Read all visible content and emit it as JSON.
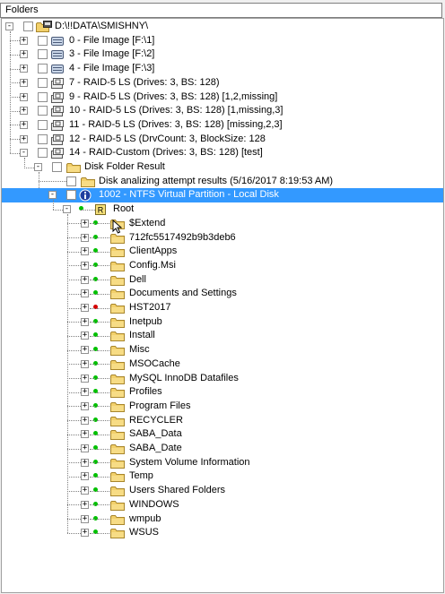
{
  "header": {
    "title": "Folders"
  },
  "tree": {
    "root": {
      "label": "D:\\!!DATA\\SMISHNY\\"
    },
    "items": [
      {
        "label": "0 - File Image [F:\\1]",
        "icon": "disk-image-icon"
      },
      {
        "label": "3 - File Image [F:\\2]",
        "icon": "disk-image-icon"
      },
      {
        "label": "4 - File Image [F:\\3]",
        "icon": "disk-image-icon"
      },
      {
        "label": "7 - RAID-5 LS (Drives: 3, BS: 128)",
        "icon": "raid-icon"
      },
      {
        "label": "9 - RAID-5 LS (Drives: 3, BS: 128) [1,2,missing]",
        "icon": "raid-icon"
      },
      {
        "label": "10 - RAID-5 LS (Drives: 3, BS: 128) [1,missing,3]",
        "icon": "raid-icon"
      },
      {
        "label": "11 - RAID-5 LS (Drives: 3, BS: 128) [missing,2,3]",
        "icon": "raid-icon"
      },
      {
        "label": "12 - RAID-5 LS (DrvCount: 3, BlockSize: 128",
        "icon": "raid-icon"
      },
      {
        "label": "14 - RAID-Custom (Drives: 3, BS: 128) [test]",
        "icon": "raid-icon"
      }
    ],
    "disk_folder": {
      "label": "Disk Folder Result"
    },
    "attempt": {
      "label": "Disk analizing attempt results (5/16/2017 8:19:53 AM)"
    },
    "partition": {
      "label": "1002 - NTFS Virtual Partition - Local Disk",
      "selected": true
    },
    "root_folder": {
      "label": "Root",
      "badge": "R"
    },
    "folders": [
      {
        "label": "$Extend",
        "status": "green",
        "cursor": true
      },
      {
        "label": "712fc5517492b9b3deb6",
        "status": "green"
      },
      {
        "label": "ClientApps",
        "status": "green"
      },
      {
        "label": "Config.Msi",
        "status": "green"
      },
      {
        "label": "Dell",
        "status": "green"
      },
      {
        "label": "Documents and Settings",
        "status": "green"
      },
      {
        "label": "HST2017",
        "status": "red"
      },
      {
        "label": "Inetpub",
        "status": "green"
      },
      {
        "label": "Install",
        "status": "green"
      },
      {
        "label": "Misc",
        "status": "green"
      },
      {
        "label": "MSOCache",
        "status": "green"
      },
      {
        "label": "MySQL InnoDB Datafiles",
        "status": "green"
      },
      {
        "label": "Profiles",
        "status": "green"
      },
      {
        "label": "Program Files",
        "status": "green"
      },
      {
        "label": "RECYCLER",
        "status": "green"
      },
      {
        "label": "SABA_Data",
        "status": "green"
      },
      {
        "label": "SABA_Date",
        "status": "green"
      },
      {
        "label": "System Volume Information",
        "status": "green"
      },
      {
        "label": "Temp",
        "status": "green"
      },
      {
        "label": "Users Shared Folders",
        "status": "green"
      },
      {
        "label": "WINDOWS",
        "status": "green"
      },
      {
        "label": "wmpub",
        "status": "green"
      },
      {
        "label": "WSUS",
        "status": "green"
      }
    ]
  },
  "colors": {
    "selection": "#3399ff",
    "ok": "#00c000",
    "error": "#d40000",
    "folder": "#f2d06b"
  }
}
